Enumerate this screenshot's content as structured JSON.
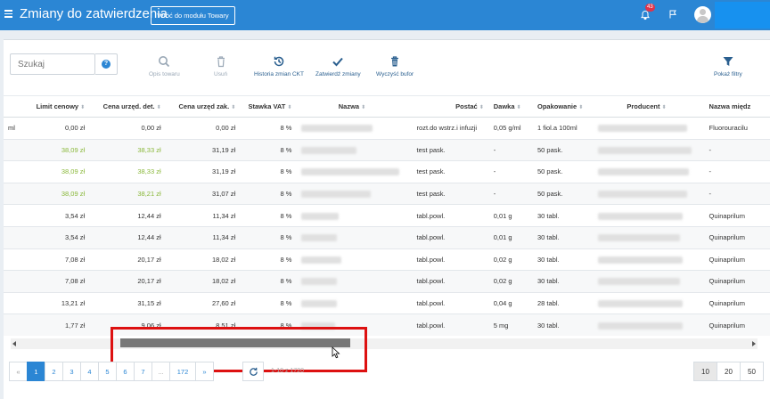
{
  "header": {
    "title": "Zmiany do zatwierdzenia",
    "back_button": "Wróć do modułu Towary",
    "notification_count": "43"
  },
  "toolbar": {
    "search_placeholder": "Szukaj",
    "help_label": "?",
    "actions": [
      {
        "label": "Opis towaru",
        "icon": "search-icon",
        "enabled": false
      },
      {
        "label": "Usuń",
        "icon": "trash-icon",
        "enabled": false
      },
      {
        "label": "Historia zmian CKT",
        "icon": "history-icon",
        "enabled": true
      },
      {
        "label": "Zatwierdź zmiany",
        "icon": "check-icon",
        "enabled": true
      },
      {
        "label": "Wyczyść bufor",
        "icon": "trash-icon",
        "enabled": true
      }
    ],
    "filters_label": "Pokaż filtry"
  },
  "table": {
    "columns": [
      "Limit cenowy",
      "Cena urzęd. det.",
      "Cena urzęd zak.",
      "Stawka VAT",
      "Nazwa",
      "Postać",
      "Dawka",
      "Opakowanie",
      "Producent",
      "Nazwa międz"
    ],
    "rows": [
      {
        "c0": "ml",
        "limit": "0,00 zł",
        "det": "0,00 zł",
        "zak": "0,00 zł",
        "vat": "8 %",
        "postac": "rozt.do wstrz.i infuzji",
        "dawka": "0,05 g/ml",
        "opak": "1 fiol.a 100ml",
        "miedz": "Fluorouracilu",
        "green": false
      },
      {
        "c0": "",
        "limit": "38,09 zł",
        "det": "38,33 zł",
        "zak": "31,19 zł",
        "vat": "8 %",
        "postac": "test pask.",
        "dawka": "-",
        "opak": "50 pask.",
        "miedz": "-",
        "green": true
      },
      {
        "c0": "",
        "limit": "38,09 zł",
        "det": "38,33 zł",
        "zak": "31,19 zł",
        "vat": "8 %",
        "postac": "test pask.",
        "dawka": "-",
        "opak": "50 pask.",
        "miedz": "-",
        "green": true
      },
      {
        "c0": "",
        "limit": "38,09 zł",
        "det": "38,21 zł",
        "zak": "31,07 zł",
        "vat": "8 %",
        "postac": "test pask.",
        "dawka": "-",
        "opak": "50 pask.",
        "miedz": "-",
        "green": true
      },
      {
        "c0": "",
        "limit": "3,54 zł",
        "det": "12,44 zł",
        "zak": "11,34 zł",
        "vat": "8 %",
        "postac": "tabl.powl.",
        "dawka": "0,01 g",
        "opak": "30 tabl.",
        "miedz": "Quinaprilum",
        "green": false
      },
      {
        "c0": "",
        "limit": "3,54 zł",
        "det": "12,44 zł",
        "zak": "11,34 zł",
        "vat": "8 %",
        "postac": "tabl.powl.",
        "dawka": "0,01 g",
        "opak": "30 tabl.",
        "miedz": "Quinaprilum",
        "green": false
      },
      {
        "c0": "",
        "limit": "7,08 zł",
        "det": "20,17 zł",
        "zak": "18,02 zł",
        "vat": "8 %",
        "postac": "tabl.powl.",
        "dawka": "0,02 g",
        "opak": "30 tabl.",
        "miedz": "Quinaprilum",
        "green": false
      },
      {
        "c0": "",
        "limit": "7,08 zł",
        "det": "20,17 zł",
        "zak": "18,02 zł",
        "vat": "8 %",
        "postac": "tabl.powl.",
        "dawka": "0,02 g",
        "opak": "30 tabl.",
        "miedz": "Quinaprilum",
        "green": false
      },
      {
        "c0": "",
        "limit": "13,21 zł",
        "det": "31,15 zł",
        "zak": "27,60 zł",
        "vat": "8 %",
        "postac": "tabl.powl.",
        "dawka": "0,04 g",
        "opak": "28 tabl.",
        "miedz": "Quinaprilum",
        "green": false
      },
      {
        "c0": "",
        "limit": "1,77 zł",
        "det": "9,06 zł",
        "zak": "8,51 zł",
        "vat": "8 %",
        "postac": "tabl.powl.",
        "dawka": "5 mg",
        "opak": "30 tabl.",
        "miedz": "Quinaprilum",
        "green": false
      }
    ]
  },
  "pagination": {
    "prev": "«",
    "pages": [
      "1",
      "2",
      "3",
      "4",
      "5",
      "6",
      "7",
      "...",
      "172"
    ],
    "next": "»",
    "range": "1-10 z 1720",
    "sizes": [
      "10",
      "20",
      "50"
    ]
  }
}
